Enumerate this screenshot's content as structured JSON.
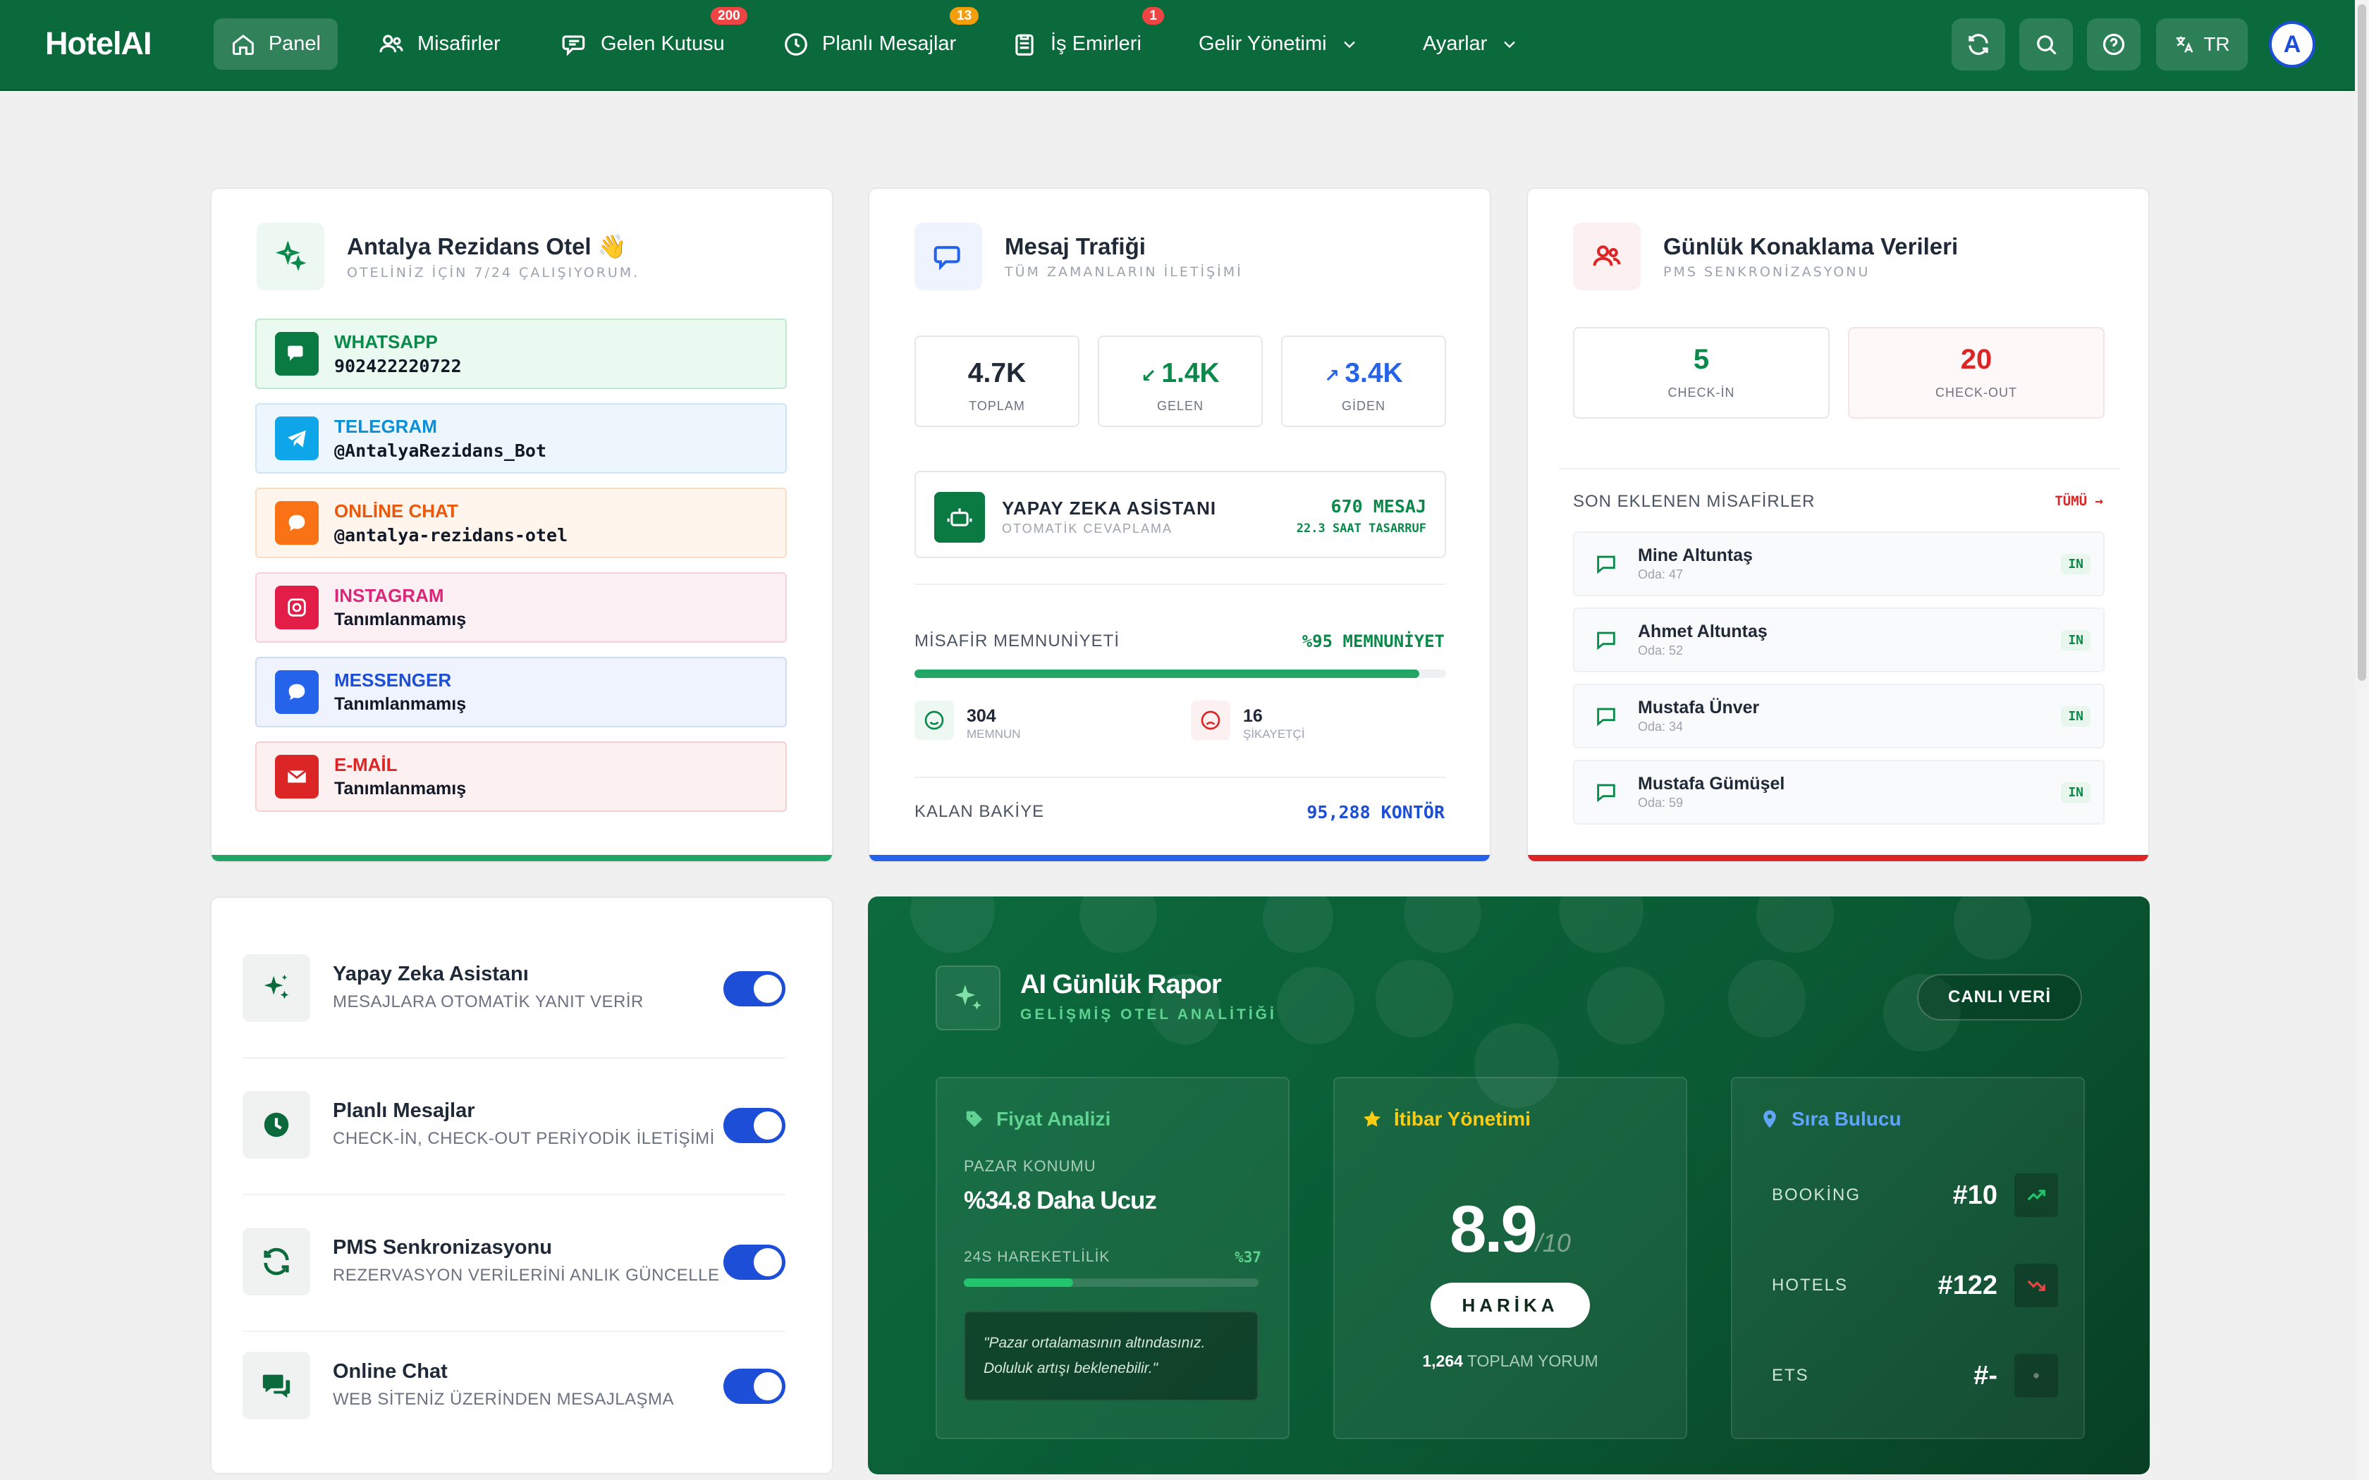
{
  "app": {
    "logo": "HotelAI"
  },
  "nav": {
    "items": [
      {
        "label": "Panel",
        "active": true
      },
      {
        "label": "Misafirler"
      },
      {
        "label": "Gelen Kutusu",
        "badge": "200"
      },
      {
        "label": "Planlı Mesajlar",
        "badge": "13"
      },
      {
        "label": "İş Emirleri",
        "badge": "1"
      },
      {
        "label": "Gelir Yönetimi"
      },
      {
        "label": "Ayarlar"
      }
    ],
    "lang": "TR",
    "avatar": "A",
    "icons": [
      "refresh-icon",
      "search-icon",
      "help-icon",
      "translate-icon"
    ]
  },
  "hotel": {
    "title": "Antalya Rezidans Otel 👋",
    "subtitle": "OTELİNİZ İÇİN 7/24 ÇALIŞIYORUM.",
    "channels": [
      {
        "name": "WHATSAPP",
        "value": "902422220722",
        "color": "#0a8a4a",
        "icon": "whatsapp-icon"
      },
      {
        "name": "TELEGRAM",
        "value": "@AntalyaRezidans_Bot",
        "color": "#0b8fd6",
        "icon": "telegram-icon"
      },
      {
        "name": "ONLİNE CHAT",
        "value": "@antalya-rezidans-otel",
        "color": "#ea580c",
        "icon": "chat-icon"
      },
      {
        "name": "INSTAGRAM",
        "value": "Tanımlanmamış",
        "color": "#db2777",
        "icon": "instagram-icon"
      },
      {
        "name": "MESSENGER",
        "value": "Tanımlanmamış",
        "color": "#1d4ed8",
        "icon": "messenger-icon"
      },
      {
        "name": "E-MAİL",
        "value": "Tanımlanmamış",
        "color": "#dc2626",
        "icon": "mail-icon"
      }
    ]
  },
  "traffic": {
    "title": "Mesaj Trafiği",
    "subtitle": "TÜM ZAMANLARIN İLETİŞİMİ",
    "total": {
      "value": "4.7K",
      "label": "TOPLAM"
    },
    "incoming": {
      "value": "1.4K",
      "label": "GELEN"
    },
    "outgoing": {
      "value": "3.4K",
      "label": "GİDEN"
    },
    "assistant": {
      "title": "YAPAY ZEKA ASİSTANI",
      "subtitle": "OTOMATİK CEVAPLAMA",
      "count": "670 MESAJ",
      "saving": "22.3 SAAT TASARRUF"
    },
    "satisfaction": {
      "label": "MİSAFİR MEMNUNİYETİ",
      "value": "%95 MEMNUNİYET",
      "level": 0.95
    },
    "happy": {
      "value": "304",
      "label": "MEMNUN"
    },
    "complain": {
      "value": "16",
      "label": "ŞİKAYETÇİ"
    },
    "balance": {
      "label": "KALAN BAKİYE",
      "value": "95,288 KONTÖR"
    }
  },
  "stay": {
    "title": "Günlük Konaklama Verileri",
    "subtitle": "PMS SENKRONİZASYONU",
    "checkin": {
      "value": "5",
      "label": "CHECK-İN"
    },
    "checkout": {
      "value": "20",
      "label": "CHECK-OUT"
    },
    "recent_label": "SON EKLENEN MİSAFİRLER",
    "all_link": "TÜMÜ",
    "guests": [
      {
        "name": "Mine Altuntaş",
        "room": "Oda: 47",
        "status": "IN"
      },
      {
        "name": "Ahmet Altuntaş",
        "room": "Oda: 52",
        "status": "IN"
      },
      {
        "name": "Mustafa Ünver",
        "room": "Oda: 34",
        "status": "IN"
      },
      {
        "name": "Mustafa Gümüşel",
        "room": "Oda: 59",
        "status": "IN"
      }
    ]
  },
  "features": [
    {
      "title": "Yapay Zeka Asistanı",
      "subtitle": "MESAJLARA OTOMATİK YANIT VERİR",
      "on": true,
      "icon": "sparkles-icon"
    },
    {
      "title": "Planlı Mesajlar",
      "subtitle": "CHECK-İN, CHECK-OUT PERİYODİK İLETİŞİMİ",
      "on": true,
      "icon": "clock-icon"
    },
    {
      "title": "PMS Senkronizasyonu",
      "subtitle": "REZERVASYON VERİLERİNİ ANLIK GÜNCELLE",
      "on": true,
      "icon": "sync-icon"
    },
    {
      "title": "Online Chat",
      "subtitle": "WEB SİTENİZ ÜZERİNDEN MESAJLAŞMA",
      "on": true,
      "icon": "chat-bubbles-icon"
    }
  ],
  "report": {
    "title": "AI Günlük Rapor",
    "subtitle": "GELİŞMİŞ OTEL ANALİTİĞİ",
    "live": "CANLI VERİ",
    "price": {
      "title": "Fiyat Analizi",
      "market_label": "PAZAR KONUMU",
      "market_value": "%34.8 Daha Ucuz",
      "volatility_label": "24S HAREKETLİLİK",
      "volatility_value": "%37",
      "volatility_level": 0.37,
      "quote": "\"Pazar ortalamasının altındasınız. Doluluk artışı beklenebilir.\""
    },
    "reputation": {
      "title": "İtibar Yönetimi",
      "score": "8.9",
      "max": "/10",
      "badge": "HARİKA",
      "reviews_count": "1,264",
      "reviews_label": "TOPLAM YORUM"
    },
    "rank": {
      "title": "Sıra Bulucu",
      "rows": [
        {
          "label": "BOOKİNG",
          "value": "#10",
          "trend": "up"
        },
        {
          "label": "HOTELS",
          "value": "#122",
          "trend": "down"
        },
        {
          "label": "ETS",
          "value": "#-",
          "trend": "none"
        }
      ]
    }
  },
  "colors": {
    "brand": "#0a6a3c",
    "accent_blue": "#1d4ed8",
    "accent_red": "#dc2626",
    "accent_green": "#22a565"
  }
}
